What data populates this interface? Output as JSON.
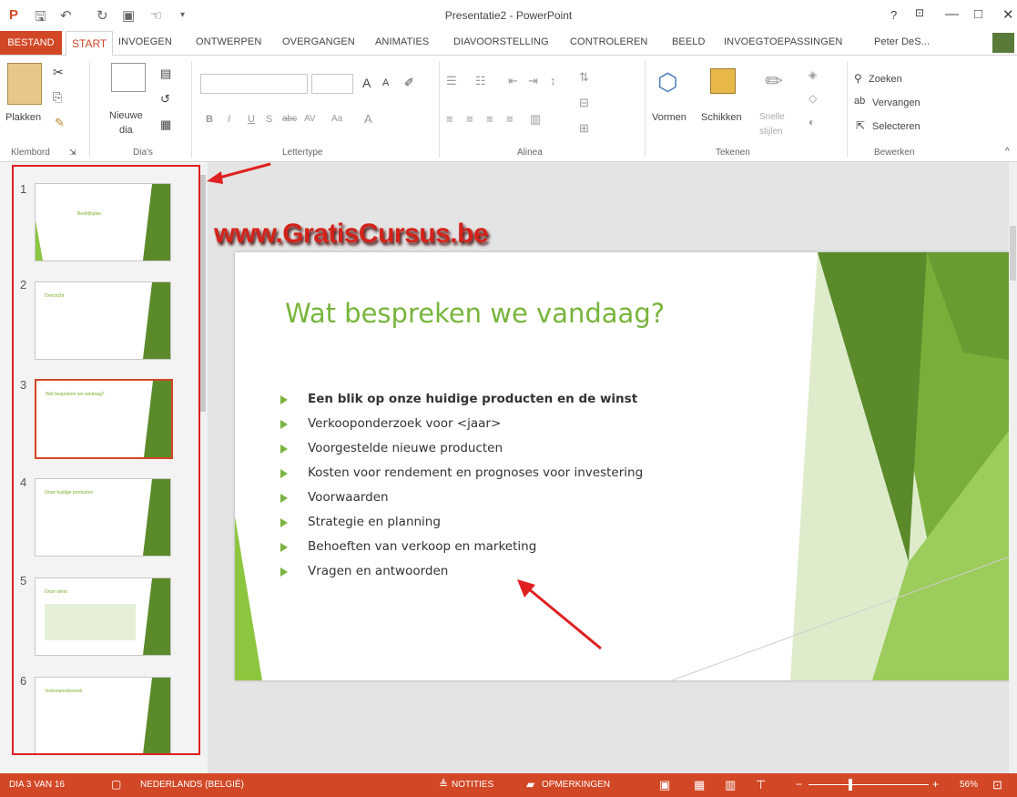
{
  "window": {
    "title": "Presentatie2 - PowerPoint",
    "help": "?",
    "minimize": "—",
    "maximize": "□",
    "close": "✕",
    "user": "Peter DeS..."
  },
  "tabs": [
    "BESTAND",
    "START",
    "INVOEGEN",
    "ONTWERPEN",
    "OVERGANGEN",
    "ANIMATIES",
    "DIAVOORSTELLING",
    "CONTROLEREN",
    "BEELD",
    "INVOEGTOEPASSINGEN"
  ],
  "ribbon": {
    "paste": "Plakken",
    "new_slide_1": "Nieuwe",
    "new_slide_2": "dia",
    "font_grow": "A",
    "font_shrink": "A",
    "shapes": "Vormen",
    "arrange": "Schikken",
    "quick_styles_1": "Snelle",
    "quick_styles_2": "stijlen",
    "find": "Zoeken",
    "replace": "Vervangen",
    "select": "Selecteren",
    "groups": [
      "Klembord",
      "Dia's",
      "Lettertype",
      "Alinea",
      "Tekenen",
      "Bewerken"
    ]
  },
  "watermark": "www.GratisCursus.be",
  "thumbnails": [
    {
      "num": "1",
      "title": "Bedrijfsplan"
    },
    {
      "num": "2",
      "title": "Overzicht"
    },
    {
      "num": "3",
      "title": "Wat bespreken we vandaag?"
    },
    {
      "num": "4",
      "title": "Onze huidige producten"
    },
    {
      "num": "5",
      "title": "Onze winst"
    },
    {
      "num": "6",
      "title": "Verkooponderzoek"
    }
  ],
  "slide": {
    "title": "Wat bespreken we vandaag?",
    "bullets": [
      "Een blik op onze huidige producten en de winst",
      "Verkooponderzoek voor <jaar>",
      "Voorgestelde nieuwe producten",
      "Kosten voor rendement en prognoses voor investering",
      "Voorwaarden",
      "Strategie en planning",
      "Behoeften van verkoop en marketing",
      "Vragen en antwoorden"
    ]
  },
  "status": {
    "slide_pos": "DIA 3 VAN 16",
    "language": "NEDERLANDS (BELGIË)",
    "notes": "NOTITIES",
    "comments": "OPMERKINGEN",
    "zoom": "56%"
  },
  "colors": {
    "accent": "#d24726",
    "green": "#78b43c",
    "annotation_red": "#e02020"
  }
}
